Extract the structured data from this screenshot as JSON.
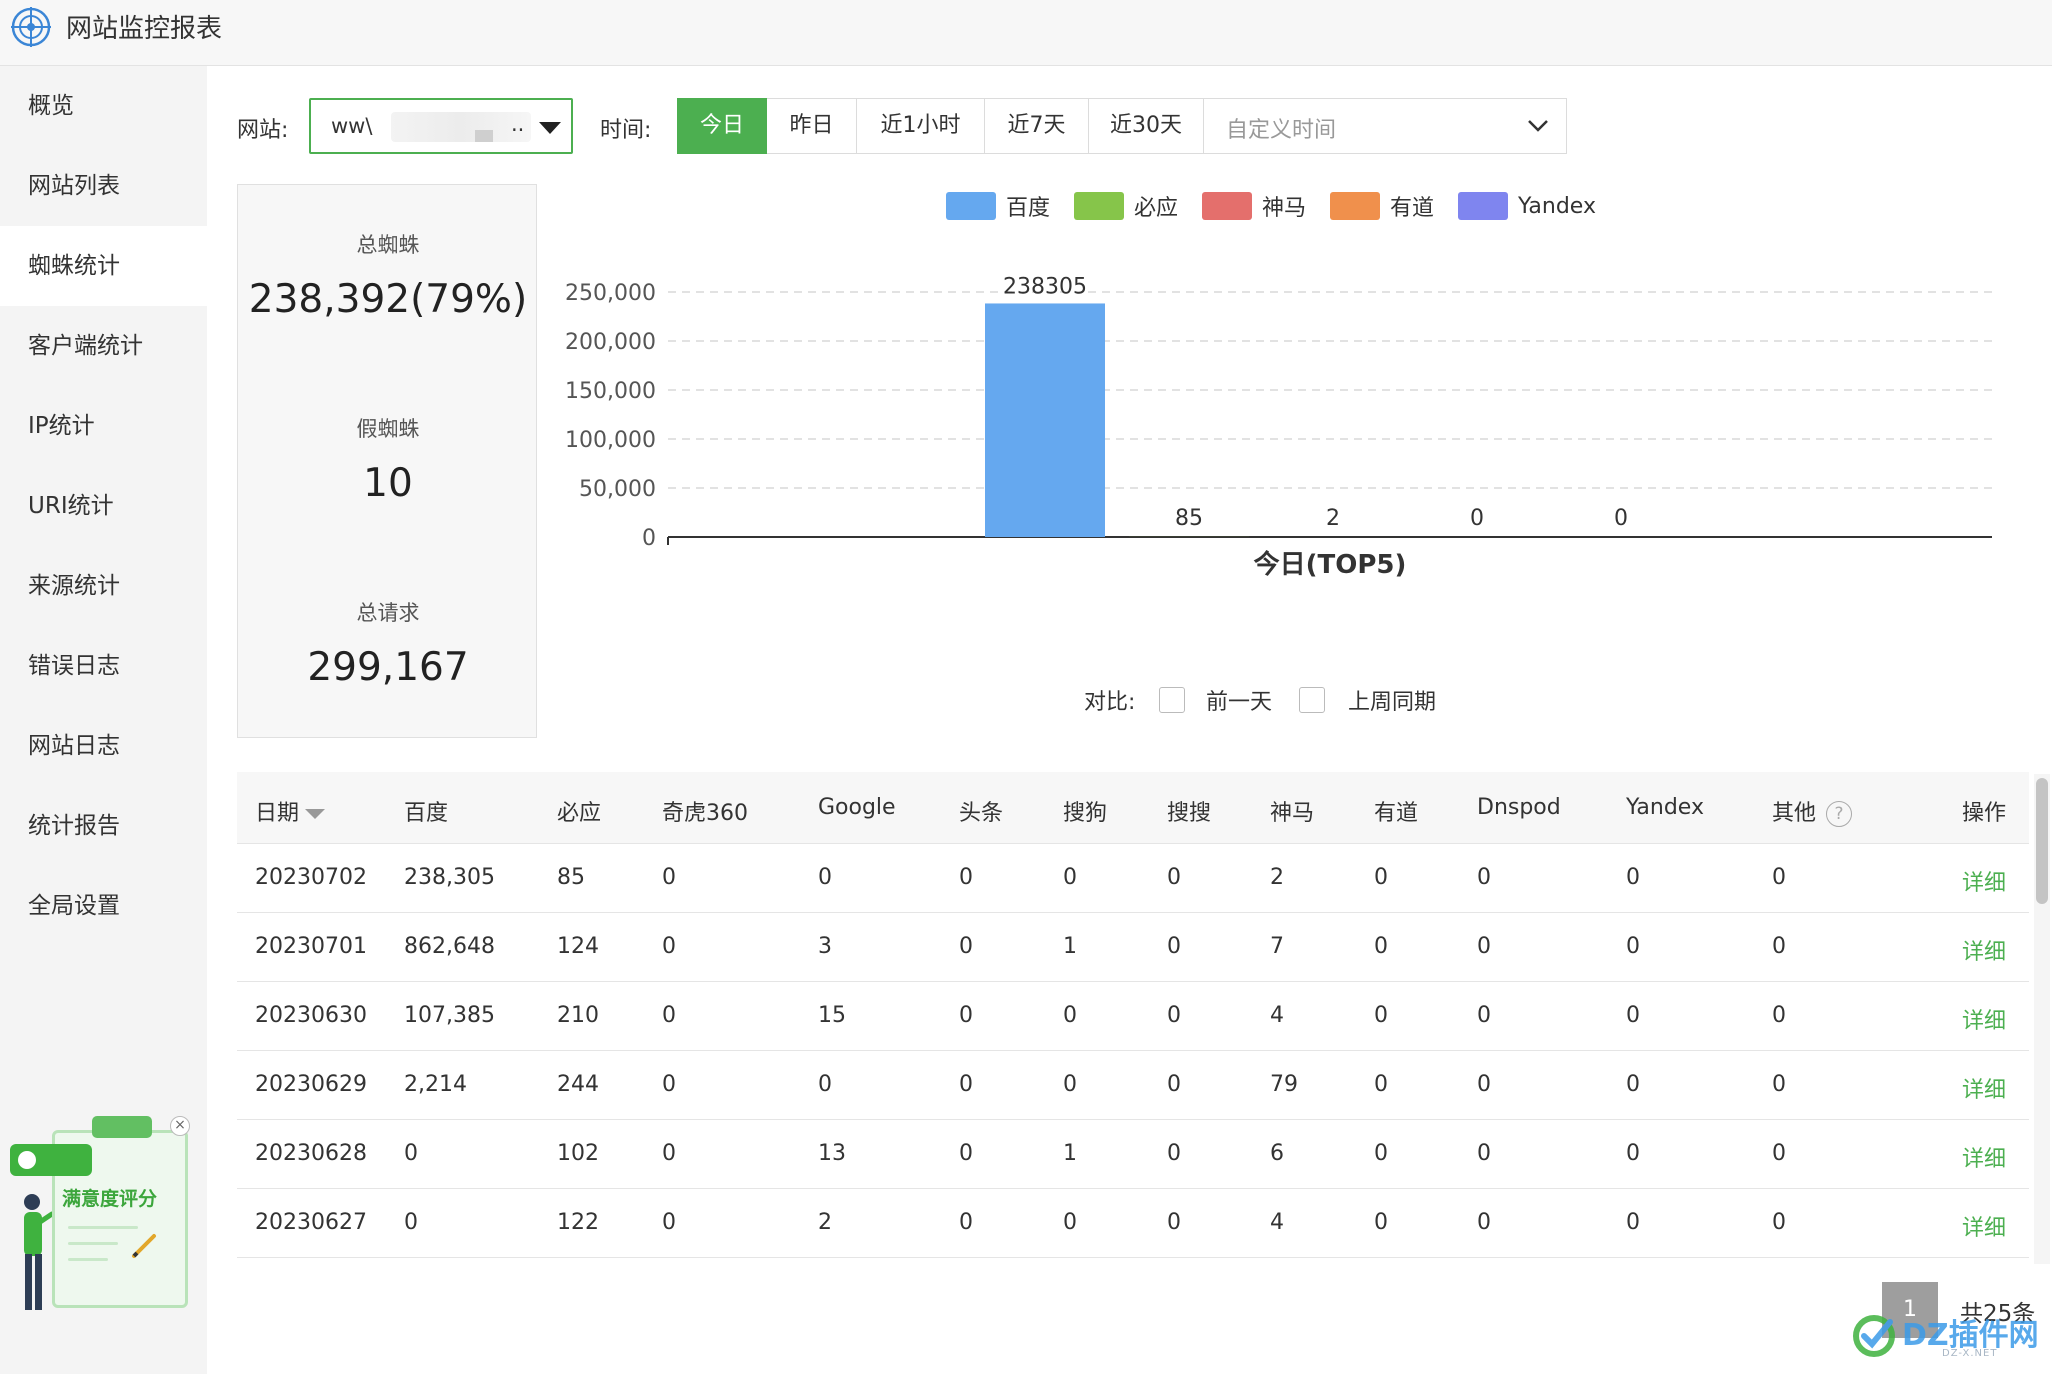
{
  "header": {
    "title": "网站监控报表"
  },
  "sidebar": {
    "items": [
      {
        "label": "概览"
      },
      {
        "label": "网站列表"
      },
      {
        "label": "蜘蛛统计",
        "active": true
      },
      {
        "label": "客户端统计"
      },
      {
        "label": "IP统计"
      },
      {
        "label": "URI统计"
      },
      {
        "label": "来源统计"
      },
      {
        "label": "错误日志"
      },
      {
        "label": "网站日志"
      },
      {
        "label": "统计报告"
      },
      {
        "label": "全局设置"
      }
    ],
    "survey_label": "满意度评分"
  },
  "filters": {
    "site_label": "网站:",
    "site_value": "ww\\",
    "site_suffix": "..",
    "time_label": "时间:",
    "time_options": [
      "今日",
      "昨日",
      "近1小时",
      "近7天",
      "近30天"
    ],
    "time_selected": "今日",
    "custom_time_placeholder": "自定义时间"
  },
  "stats": {
    "total_spiders_label": "总蜘蛛",
    "total_spiders_value": "238,392(79%)",
    "fake_spiders_label": "假蜘蛛",
    "fake_spiders_value": "10",
    "total_requests_label": "总请求",
    "total_requests_value": "299,167"
  },
  "chart_data": {
    "type": "bar",
    "xlabel": "今日(TOP5)",
    "series": [
      {
        "name": "百度",
        "value": 238305,
        "color": "#65a8ef"
      },
      {
        "name": "必应",
        "value": 85,
        "color": "#86c54a"
      },
      {
        "name": "神马",
        "value": 2,
        "color": "#e46f6c"
      },
      {
        "name": "有道",
        "value": 0,
        "color": "#f0904c"
      },
      {
        "name": "Yandex",
        "value": 0,
        "color": "#7f85ef"
      }
    ],
    "ylim": [
      0,
      250000
    ],
    "yticks": [
      "0",
      "50,000",
      "100,000",
      "150,000",
      "200,000",
      "250,000"
    ],
    "grid": true,
    "legend_position": "top"
  },
  "compare": {
    "label": "对比:",
    "options": [
      "前一天",
      "上周同期"
    ]
  },
  "table": {
    "columns": [
      "日期",
      "百度",
      "必应",
      "奇虎360",
      "Google",
      "头条",
      "搜狗",
      "搜搜",
      "神马",
      "有道",
      "Dnspod",
      "Yandex",
      "其他",
      "操作"
    ],
    "rows": [
      [
        "20230702",
        "238,305",
        "85",
        "0",
        "0",
        "0",
        "0",
        "0",
        "2",
        "0",
        "0",
        "0",
        "0",
        "详细"
      ],
      [
        "20230701",
        "862,648",
        "124",
        "0",
        "3",
        "0",
        "1",
        "0",
        "7",
        "0",
        "0",
        "0",
        "0",
        "详细"
      ],
      [
        "20230630",
        "107,385",
        "210",
        "0",
        "15",
        "0",
        "0",
        "0",
        "4",
        "0",
        "0",
        "0",
        "0",
        "详细"
      ],
      [
        "20230629",
        "2,214",
        "244",
        "0",
        "0",
        "0",
        "0",
        "0",
        "79",
        "0",
        "0",
        "0",
        "0",
        "详细"
      ],
      [
        "20230628",
        "0",
        "102",
        "0",
        "13",
        "0",
        "1",
        "0",
        "6",
        "0",
        "0",
        "0",
        "0",
        "详细"
      ],
      [
        "20230627",
        "0",
        "122",
        "0",
        "2",
        "0",
        "0",
        "0",
        "4",
        "0",
        "0",
        "0",
        "0",
        "详细"
      ]
    ]
  },
  "pagination": {
    "current_page": "1",
    "total_text": "共25条"
  },
  "watermark": {
    "text": "DZ插件网",
    "sub": "DZ-X.NET"
  },
  "colors": {
    "accent": "#4caf50",
    "bar_baidu": "#65a8ef"
  }
}
